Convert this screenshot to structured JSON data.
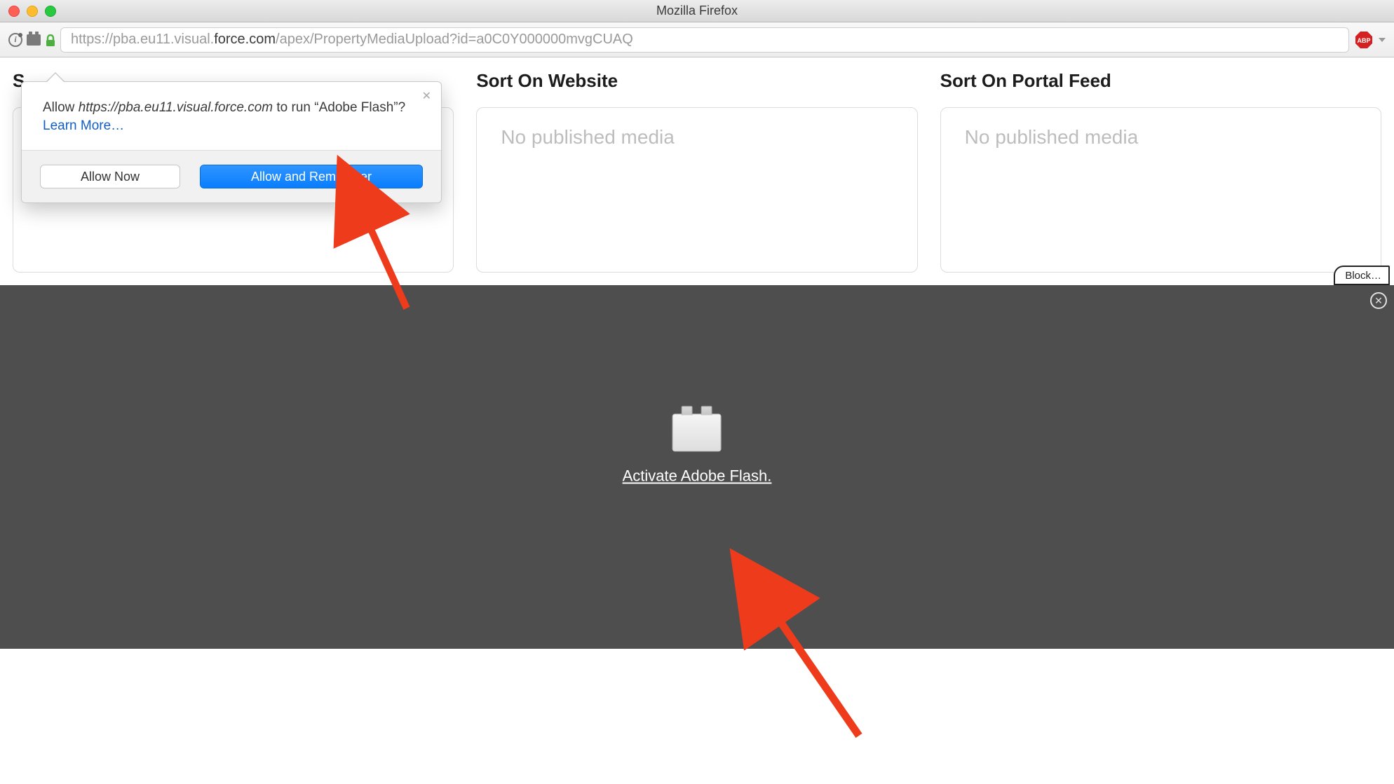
{
  "titlebar": {
    "title": "Mozilla Firefox"
  },
  "url": {
    "prefix": "https://pba.eu11.visual.",
    "domain": "force.com",
    "path": "/apex/PropertyMediaUpload?id=a0C0Y000000mvgCUAQ"
  },
  "columns": [
    {
      "heading": "S",
      "empty": ""
    },
    {
      "heading": "Sort On Website",
      "empty": "No published media"
    },
    {
      "heading": "Sort On Portal Feed",
      "empty": "No published media"
    }
  ],
  "perm": {
    "allow": "Allow ",
    "origin": "https://pba.eu11.visual.force.com",
    "to_run": " to run “Adobe Flash”? ",
    "learn_more": "Learn More…",
    "allow_now": "Allow Now",
    "allow_remember": "Allow and Remember"
  },
  "flash": {
    "block_chip": "Block…",
    "activate": "Activate Adobe Flash."
  },
  "abp_label": "ABP"
}
